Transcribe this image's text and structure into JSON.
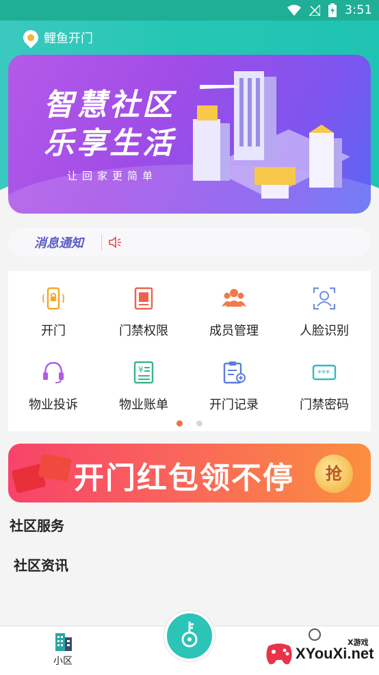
{
  "status_bar": {
    "time": "3:51"
  },
  "header": {
    "location": "鲤鱼开门"
  },
  "banner": {
    "title_line1": "智慧社区",
    "title_line2": "乐享生活",
    "subtitle": "让回家更简单"
  },
  "notice": {
    "label": "消息通知"
  },
  "grid": {
    "items": [
      {
        "label": "开门",
        "icon": "door-lock-icon",
        "color": "#f5a623"
      },
      {
        "label": "门禁权限",
        "icon": "access-card-icon",
        "color": "#f0604a"
      },
      {
        "label": "成员管理",
        "icon": "members-icon",
        "color": "#f07a4a"
      },
      {
        "label": "人脸识别",
        "icon": "face-scan-icon",
        "color": "#6f8fe0"
      },
      {
        "label": "物业投诉",
        "icon": "headset-icon",
        "color": "#b15ce6"
      },
      {
        "label": "物业账单",
        "icon": "bill-icon",
        "color": "#38b48f"
      },
      {
        "label": "开门记录",
        "icon": "record-icon",
        "color": "#5b7de0"
      },
      {
        "label": "门禁密码",
        "icon": "password-icon",
        "color": "#2fb9c9"
      }
    ]
  },
  "pagination": {
    "pages": 2,
    "active": 1
  },
  "promo": {
    "text": "开门红包领不停",
    "button": "抢"
  },
  "sections": {
    "service": "社区服务",
    "news": "社区资讯"
  },
  "bottom_nav": {
    "left_label": "小区"
  },
  "watermark": {
    "text": "XYouXi.net",
    "small": "X游戏"
  },
  "colors": {
    "teal": "#26c6b4",
    "purple": "#a04ce7",
    "accent": "#f36f3e"
  }
}
